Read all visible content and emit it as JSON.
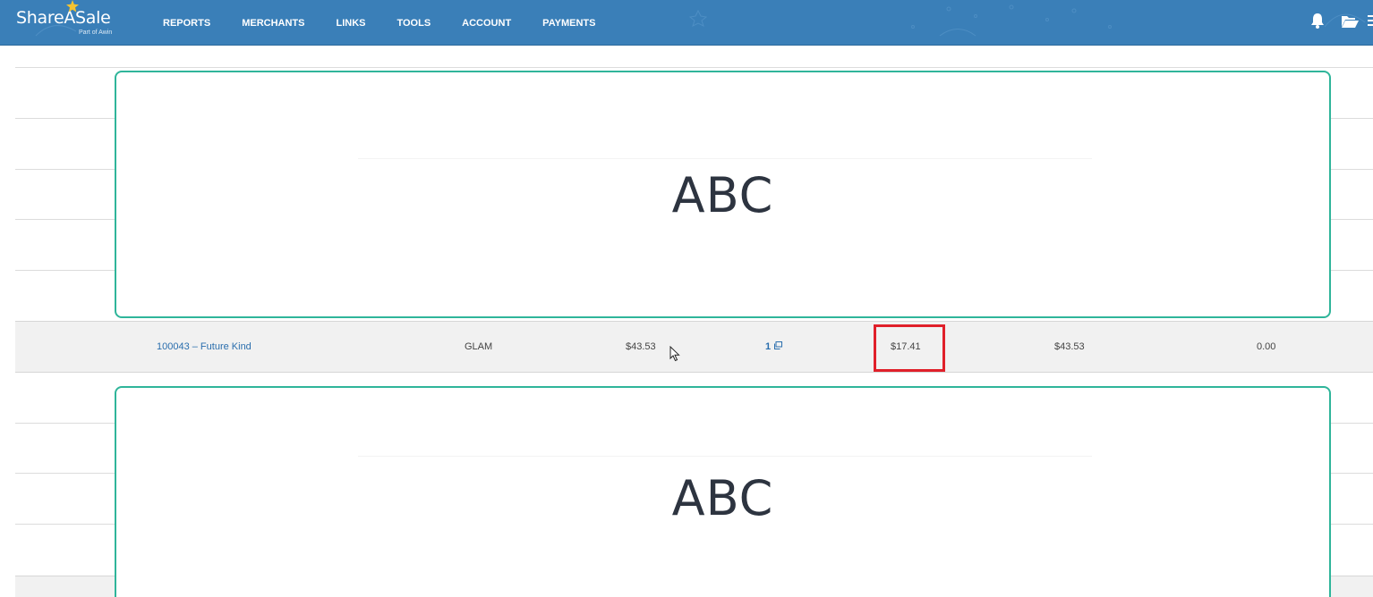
{
  "header": {
    "logo_text": "ShareASale",
    "logo_sub": "Part of Awin",
    "nav": [
      "REPORTS",
      "MERCHANTS",
      "LINKS",
      "TOOLS",
      "ACCOUNT",
      "PAYMENTS"
    ],
    "icons": [
      "bell-icon",
      "folder-open-icon",
      "menu-icon"
    ]
  },
  "ads": {
    "top_text": "ABC",
    "bottom_text": "ABC"
  },
  "row": {
    "merchant": "100043 – Future Kind",
    "category": "GLAM",
    "sale_amount": "$43.53",
    "count": "1",
    "commission": "$17.41",
    "total": "$43.53",
    "other": "0.00"
  },
  "colors": {
    "header_bg": "#3a7fb8",
    "ad_border": "#2fb59a",
    "highlight": "#e0202a",
    "link": "#2a6ead"
  }
}
